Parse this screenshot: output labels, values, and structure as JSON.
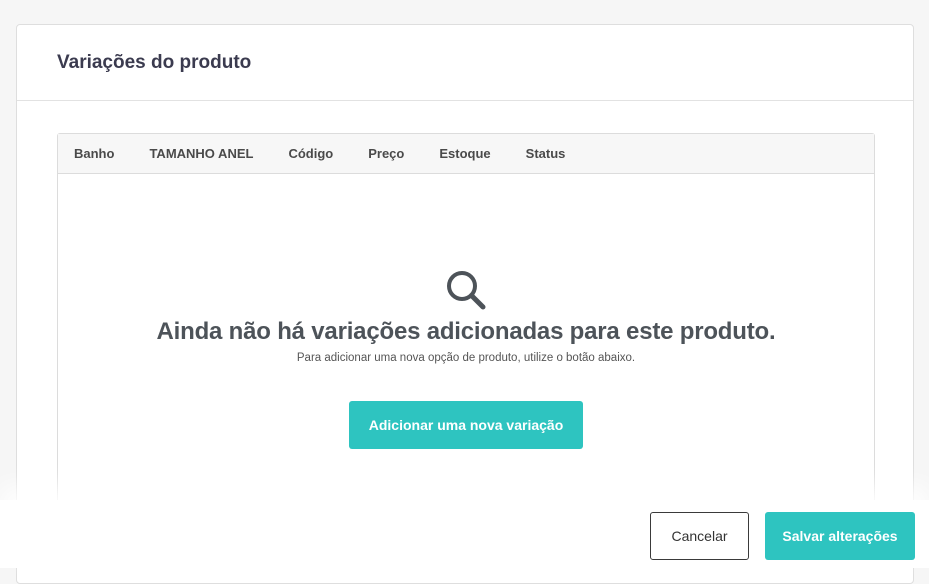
{
  "card": {
    "title": "Variações do produto"
  },
  "table": {
    "columns": [
      "Banho",
      "TAMANHO ANEL",
      "Código",
      "Preço",
      "Estoque",
      "Status"
    ]
  },
  "empty_state": {
    "icon": "search-icon",
    "title": "Ainda não há variações adicionadas para este produto.",
    "subtitle": "Para adicionar uma nova opção de produto, utilize o botão abaixo.",
    "button_label": "Adicionar uma nova variação"
  },
  "footer": {
    "cancel_label": "Cancelar",
    "save_label": "Salvar alterações"
  },
  "colors": {
    "accent": "#2ec4c0",
    "title_text": "#3b3b4f",
    "empty_text": "#4d5359"
  }
}
